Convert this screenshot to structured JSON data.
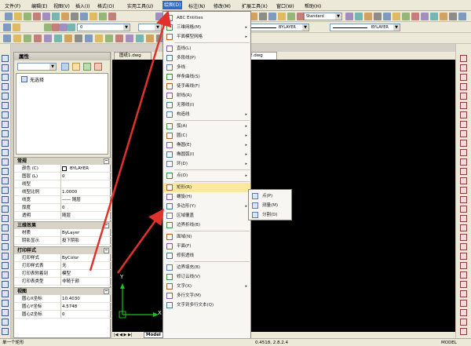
{
  "menubar": {
    "items": [
      "文件(F)",
      "编辑(E)",
      "视图(V)",
      "插入(I)",
      "格式(O)",
      "实用工具(U)",
      "绘图(D)",
      "标注(N)",
      "修改(M)",
      "扩展工具(X)",
      "窗口(W)",
      "帮助(H)"
    ],
    "active_index": 6
  },
  "toolbar": {
    "text_style": "Standard",
    "layer_value": "0",
    "linetype1": "BYLAYER",
    "linetype2": "BYLAYER"
  },
  "properties": {
    "title": "属性",
    "selection_label": "无选择",
    "sections": {
      "general": "常规",
      "view3d": "三维效果",
      "print": "打印样式",
      "view": "视图"
    },
    "general_rows": [
      {
        "k": "颜色 (C)",
        "v": "BYLAYER"
      },
      {
        "k": "图层 (L)",
        "v": "0"
      },
      {
        "k": "线型",
        "v": ""
      },
      {
        "k": "线型比例",
        "v": "1.0000"
      },
      {
        "k": "线宽",
        "v": "—— 随层"
      },
      {
        "k": "厚度",
        "v": "0"
      },
      {
        "k": "透明",
        "v": "随层"
      }
    ],
    "view3d_rows": [
      {
        "k": "材质",
        "v": "ByLayer"
      },
      {
        "k": "阴影显示",
        "v": "投下阴影"
      }
    ],
    "print_rows": [
      {
        "k": "打印样式",
        "v": "ByColor"
      },
      {
        "k": "打印样式表",
        "v": "无"
      },
      {
        "k": "打印表附着到",
        "v": "模型"
      },
      {
        "k": "打印表类型",
        "v": "非随于颜"
      }
    ],
    "view_rows": [
      {
        "k": "圆心X坐标",
        "v": "10.4030"
      },
      {
        "k": "圆心Y坐标",
        "v": "4.5748"
      },
      {
        "k": "圆心Z坐标",
        "v": "0"
      }
    ]
  },
  "document_tabs": [
    "图纸1.dwg",
    "2.dwg"
  ],
  "canvas": {
    "axis_y": "Y",
    "axis_x": "X",
    "model_tab": "Model"
  },
  "draw_menu": {
    "groups": [
      [
        "ABC Entities",
        "三维网格(M)",
        "平面模型网格"
      ],
      [
        "直线(L)",
        "多段线(P)",
        "多线",
        "样条曲线(S)",
        "徒手画线(F)",
        "射线(R)",
        "无限线(I)",
        "构造线"
      ],
      [
        "弧(A)",
        "圆(C)",
        "椭圆(E)",
        "椭圆弧(I)",
        "环(D)"
      ],
      [
        "点(O)"
      ],
      [
        "矩形(R)",
        "螺旋(H)",
        "多边形(Y)",
        "区域覆盖",
        "边界折线(B)"
      ],
      [
        "面域(N)",
        "平面(F)",
        "修剪透线"
      ],
      [
        "边界填充(B)",
        "修订云线(V)",
        "文字(X)",
        "多行文字(M)",
        "文字到多行文本(Q)"
      ]
    ],
    "has_submenu": [
      "三维网格(M)",
      "平面模型网格",
      "构造线",
      "弧(A)",
      "圆(C)",
      "椭圆(E)",
      "椭圆弧(I)",
      "环(D)",
      "点(O)",
      "多边形(Y)",
      "文字(X)"
    ],
    "highlighted": "矩形(R)"
  },
  "point_submenu": {
    "items": [
      "点(P)",
      "测量(M)",
      "分割(D)"
    ]
  },
  "status": {
    "left_text": "单一个矩形",
    "coords": "0.4518, 2.8.2.4",
    "right_text": "MODEL"
  },
  "colors": {
    "canvas": "#000000",
    "highlight": "#fbe8a0",
    "arrow": "#e0322b",
    "menu_active": "#316ac5"
  }
}
